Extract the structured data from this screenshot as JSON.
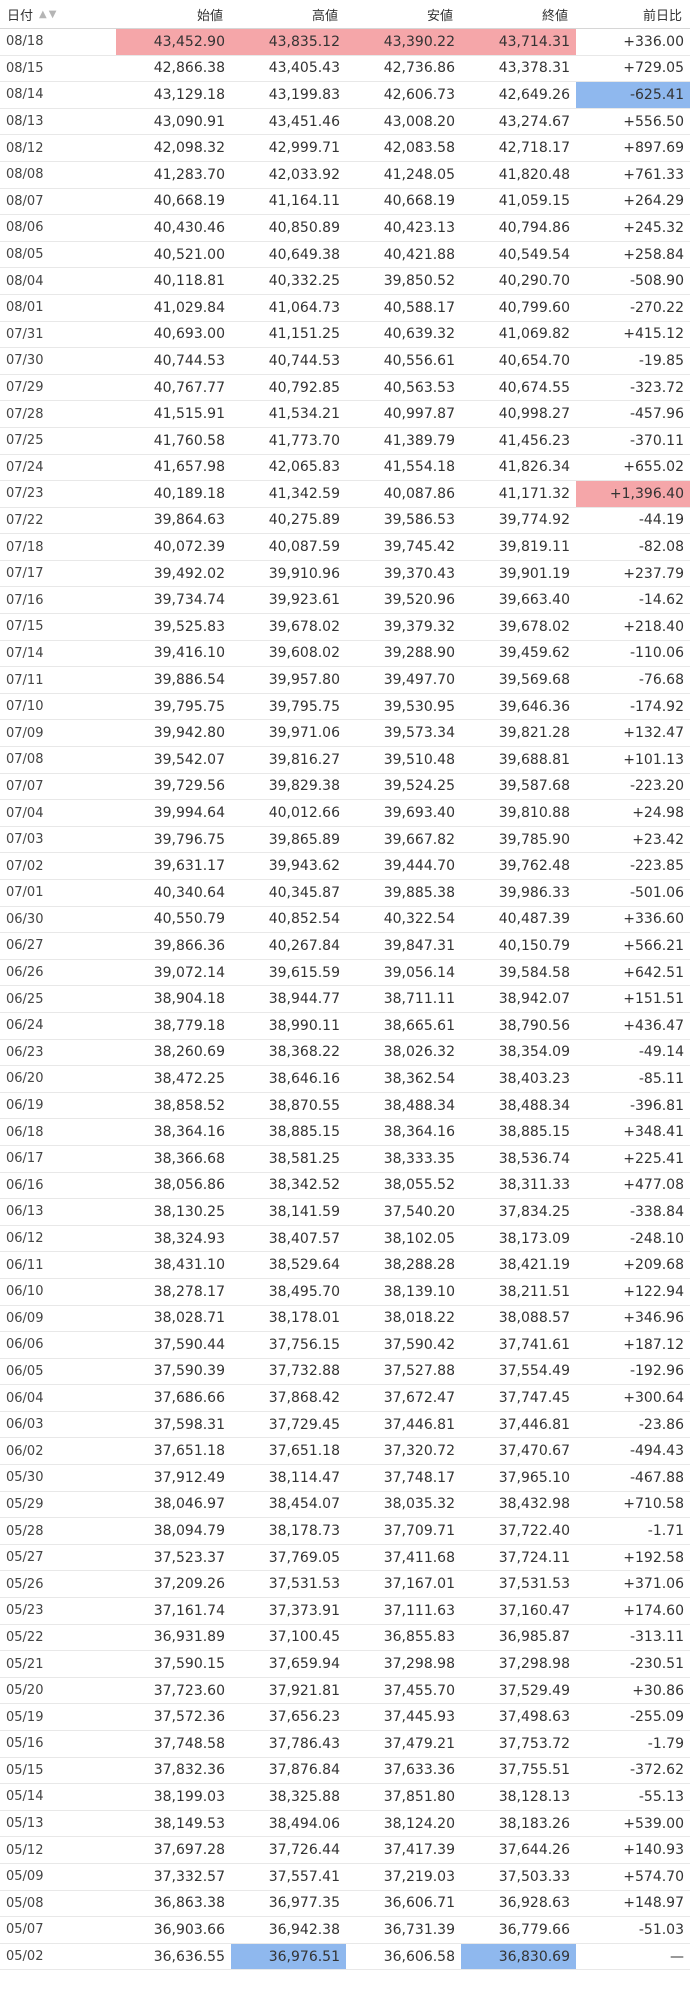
{
  "header": {
    "date": "日付",
    "open": "始値",
    "high": "高値",
    "low": "安値",
    "close": "終値",
    "change": "前日比",
    "sort_icons": [
      "sort-up-icon",
      "sort-down-icon"
    ]
  },
  "colors": {
    "positive": "#e02020",
    "negative": "#1a66c9",
    "highlight_red": "#f5a6a9",
    "highlight_blue": "#8fb8ee"
  },
  "rows": [
    {
      "date": "08/18",
      "open": "43,452.90",
      "high": "43,835.12",
      "low": "43,390.22",
      "close": "43,714.31",
      "change": "+336.00"
    },
    {
      "date": "08/15",
      "open": "42,866.38",
      "high": "43,405.43",
      "low": "42,736.86",
      "close": "43,378.31",
      "change": "+729.05"
    },
    {
      "date": "08/14",
      "open": "43,129.18",
      "high": "43,199.83",
      "low": "42,606.73",
      "close": "42,649.26",
      "change": "-625.41"
    },
    {
      "date": "08/13",
      "open": "43,090.91",
      "high": "43,451.46",
      "low": "43,008.20",
      "close": "43,274.67",
      "change": "+556.50"
    },
    {
      "date": "08/12",
      "open": "42,098.32",
      "high": "42,999.71",
      "low": "42,083.58",
      "close": "42,718.17",
      "change": "+897.69"
    },
    {
      "date": "08/08",
      "open": "41,283.70",
      "high": "42,033.92",
      "low": "41,248.05",
      "close": "41,820.48",
      "change": "+761.33"
    },
    {
      "date": "08/07",
      "open": "40,668.19",
      "high": "41,164.11",
      "low": "40,668.19",
      "close": "41,059.15",
      "change": "+264.29"
    },
    {
      "date": "08/06",
      "open": "40,430.46",
      "high": "40,850.89",
      "low": "40,423.13",
      "close": "40,794.86",
      "change": "+245.32"
    },
    {
      "date": "08/05",
      "open": "40,521.00",
      "high": "40,649.38",
      "low": "40,421.88",
      "close": "40,549.54",
      "change": "+258.84"
    },
    {
      "date": "08/04",
      "open": "40,118.81",
      "high": "40,332.25",
      "low": "39,850.52",
      "close": "40,290.70",
      "change": "-508.90"
    },
    {
      "date": "08/01",
      "open": "41,029.84",
      "high": "41,064.73",
      "low": "40,588.17",
      "close": "40,799.60",
      "change": "-270.22"
    },
    {
      "date": "07/31",
      "open": "40,693.00",
      "high": "41,151.25",
      "low": "40,639.32",
      "close": "41,069.82",
      "change": "+415.12"
    },
    {
      "date": "07/30",
      "open": "40,744.53",
      "high": "40,744.53",
      "low": "40,556.61",
      "close": "40,654.70",
      "change": "-19.85"
    },
    {
      "date": "07/29",
      "open": "40,767.77",
      "high": "40,792.85",
      "low": "40,563.53",
      "close": "40,674.55",
      "change": "-323.72"
    },
    {
      "date": "07/28",
      "open": "41,515.91",
      "high": "41,534.21",
      "low": "40,997.87",
      "close": "40,998.27",
      "change": "-457.96"
    },
    {
      "date": "07/25",
      "open": "41,760.58",
      "high": "41,773.70",
      "low": "41,389.79",
      "close": "41,456.23",
      "change": "-370.11"
    },
    {
      "date": "07/24",
      "open": "41,657.98",
      "high": "42,065.83",
      "low": "41,554.18",
      "close": "41,826.34",
      "change": "+655.02"
    },
    {
      "date": "07/23",
      "open": "40,189.18",
      "high": "41,342.59",
      "low": "40,087.86",
      "close": "41,171.32",
      "change": "+1,396.40"
    },
    {
      "date": "07/22",
      "open": "39,864.63",
      "high": "40,275.89",
      "low": "39,586.53",
      "close": "39,774.92",
      "change": "-44.19"
    },
    {
      "date": "07/18",
      "open": "40,072.39",
      "high": "40,087.59",
      "low": "39,745.42",
      "close": "39,819.11",
      "change": "-82.08"
    },
    {
      "date": "07/17",
      "open": "39,492.02",
      "high": "39,910.96",
      "low": "39,370.43",
      "close": "39,901.19",
      "change": "+237.79"
    },
    {
      "date": "07/16",
      "open": "39,734.74",
      "high": "39,923.61",
      "low": "39,520.96",
      "close": "39,663.40",
      "change": "-14.62"
    },
    {
      "date": "07/15",
      "open": "39,525.83",
      "high": "39,678.02",
      "low": "39,379.32",
      "close": "39,678.02",
      "change": "+218.40"
    },
    {
      "date": "07/14",
      "open": "39,416.10",
      "high": "39,608.02",
      "low": "39,288.90",
      "close": "39,459.62",
      "change": "-110.06"
    },
    {
      "date": "07/11",
      "open": "39,886.54",
      "high": "39,957.80",
      "low": "39,497.70",
      "close": "39,569.68",
      "change": "-76.68"
    },
    {
      "date": "07/10",
      "open": "39,795.75",
      "high": "39,795.75",
      "low": "39,530.95",
      "close": "39,646.36",
      "change": "-174.92"
    },
    {
      "date": "07/09",
      "open": "39,942.80",
      "high": "39,971.06",
      "low": "39,573.34",
      "close": "39,821.28",
      "change": "+132.47"
    },
    {
      "date": "07/08",
      "open": "39,542.07",
      "high": "39,816.27",
      "low": "39,510.48",
      "close": "39,688.81",
      "change": "+101.13"
    },
    {
      "date": "07/07",
      "open": "39,729.56",
      "high": "39,829.38",
      "low": "39,524.25",
      "close": "39,587.68",
      "change": "-223.20"
    },
    {
      "date": "07/04",
      "open": "39,994.64",
      "high": "40,012.66",
      "low": "39,693.40",
      "close": "39,810.88",
      "change": "+24.98"
    },
    {
      "date": "07/03",
      "open": "39,796.75",
      "high": "39,865.89",
      "low": "39,667.82",
      "close": "39,785.90",
      "change": "+23.42"
    },
    {
      "date": "07/02",
      "open": "39,631.17",
      "high": "39,943.62",
      "low": "39,444.70",
      "close": "39,762.48",
      "change": "-223.85"
    },
    {
      "date": "07/01",
      "open": "40,340.64",
      "high": "40,345.87",
      "low": "39,885.38",
      "close": "39,986.33",
      "change": "-501.06"
    },
    {
      "date": "06/30",
      "open": "40,550.79",
      "high": "40,852.54",
      "low": "40,322.54",
      "close": "40,487.39",
      "change": "+336.60"
    },
    {
      "date": "06/27",
      "open": "39,866.36",
      "high": "40,267.84",
      "low": "39,847.31",
      "close": "40,150.79",
      "change": "+566.21"
    },
    {
      "date": "06/26",
      "open": "39,072.14",
      "high": "39,615.59",
      "low": "39,056.14",
      "close": "39,584.58",
      "change": "+642.51"
    },
    {
      "date": "06/25",
      "open": "38,904.18",
      "high": "38,944.77",
      "low": "38,711.11",
      "close": "38,942.07",
      "change": "+151.51"
    },
    {
      "date": "06/24",
      "open": "38,779.18",
      "high": "38,990.11",
      "low": "38,665.61",
      "close": "38,790.56",
      "change": "+436.47"
    },
    {
      "date": "06/23",
      "open": "38,260.69",
      "high": "38,368.22",
      "low": "38,026.32",
      "close": "38,354.09",
      "change": "-49.14"
    },
    {
      "date": "06/20",
      "open": "38,472.25",
      "high": "38,646.16",
      "low": "38,362.54",
      "close": "38,403.23",
      "change": "-85.11"
    },
    {
      "date": "06/19",
      "open": "38,858.52",
      "high": "38,870.55",
      "low": "38,488.34",
      "close": "38,488.34",
      "change": "-396.81"
    },
    {
      "date": "06/18",
      "open": "38,364.16",
      "high": "38,885.15",
      "low": "38,364.16",
      "close": "38,885.15",
      "change": "+348.41"
    },
    {
      "date": "06/17",
      "open": "38,366.68",
      "high": "38,581.25",
      "low": "38,333.35",
      "close": "38,536.74",
      "change": "+225.41"
    },
    {
      "date": "06/16",
      "open": "38,056.86",
      "high": "38,342.52",
      "low": "38,055.52",
      "close": "38,311.33",
      "change": "+477.08"
    },
    {
      "date": "06/13",
      "open": "38,130.25",
      "high": "38,141.59",
      "low": "37,540.20",
      "close": "37,834.25",
      "change": "-338.84"
    },
    {
      "date": "06/12",
      "open": "38,324.93",
      "high": "38,407.57",
      "low": "38,102.05",
      "close": "38,173.09",
      "change": "-248.10"
    },
    {
      "date": "06/11",
      "open": "38,431.10",
      "high": "38,529.64",
      "low": "38,288.28",
      "close": "38,421.19",
      "change": "+209.68"
    },
    {
      "date": "06/10",
      "open": "38,278.17",
      "high": "38,495.70",
      "low": "38,139.10",
      "close": "38,211.51",
      "change": "+122.94"
    },
    {
      "date": "06/09",
      "open": "38,028.71",
      "high": "38,178.01",
      "low": "38,018.22",
      "close": "38,088.57",
      "change": "+346.96"
    },
    {
      "date": "06/06",
      "open": "37,590.44",
      "high": "37,756.15",
      "low": "37,590.42",
      "close": "37,741.61",
      "change": "+187.12"
    },
    {
      "date": "06/05",
      "open": "37,590.39",
      "high": "37,732.88",
      "low": "37,527.88",
      "close": "37,554.49",
      "change": "-192.96"
    },
    {
      "date": "06/04",
      "open": "37,686.66",
      "high": "37,868.42",
      "low": "37,672.47",
      "close": "37,747.45",
      "change": "+300.64"
    },
    {
      "date": "06/03",
      "open": "37,598.31",
      "high": "37,729.45",
      "low": "37,446.81",
      "close": "37,446.81",
      "change": "-23.86"
    },
    {
      "date": "06/02",
      "open": "37,651.18",
      "high": "37,651.18",
      "low": "37,320.72",
      "close": "37,470.67",
      "change": "-494.43"
    },
    {
      "date": "05/30",
      "open": "37,912.49",
      "high": "38,114.47",
      "low": "37,748.17",
      "close": "37,965.10",
      "change": "-467.88"
    },
    {
      "date": "05/29",
      "open": "38,046.97",
      "high": "38,454.07",
      "low": "38,035.32",
      "close": "38,432.98",
      "change": "+710.58"
    },
    {
      "date": "05/28",
      "open": "38,094.79",
      "high": "38,178.73",
      "low": "37,709.71",
      "close": "37,722.40",
      "change": "-1.71"
    },
    {
      "date": "05/27",
      "open": "37,523.37",
      "high": "37,769.05",
      "low": "37,411.68",
      "close": "37,724.11",
      "change": "+192.58"
    },
    {
      "date": "05/26",
      "open": "37,209.26",
      "high": "37,531.53",
      "low": "37,167.01",
      "close": "37,531.53",
      "change": "+371.06"
    },
    {
      "date": "05/23",
      "open": "37,161.74",
      "high": "37,373.91",
      "low": "37,111.63",
      "close": "37,160.47",
      "change": "+174.60"
    },
    {
      "date": "05/22",
      "open": "36,931.89",
      "high": "37,100.45",
      "low": "36,855.83",
      "close": "36,985.87",
      "change": "-313.11"
    },
    {
      "date": "05/21",
      "open": "37,590.15",
      "high": "37,659.94",
      "low": "37,298.98",
      "close": "37,298.98",
      "change": "-230.51"
    },
    {
      "date": "05/20",
      "open": "37,723.60",
      "high": "37,921.81",
      "low": "37,455.70",
      "close": "37,529.49",
      "change": "+30.86"
    },
    {
      "date": "05/19",
      "open": "37,572.36",
      "high": "37,656.23",
      "low": "37,445.93",
      "close": "37,498.63",
      "change": "-255.09"
    },
    {
      "date": "05/16",
      "open": "37,748.58",
      "high": "37,786.43",
      "low": "37,479.21",
      "close": "37,753.72",
      "change": "-1.79"
    },
    {
      "date": "05/15",
      "open": "37,832.36",
      "high": "37,876.84",
      "low": "37,633.36",
      "close": "37,755.51",
      "change": "-372.62"
    },
    {
      "date": "05/14",
      "open": "38,199.03",
      "high": "38,325.88",
      "low": "37,851.80",
      "close": "38,128.13",
      "change": "-55.13"
    },
    {
      "date": "05/13",
      "open": "38,149.53",
      "high": "38,494.06",
      "low": "38,124.20",
      "close": "38,183.26",
      "change": "+539.00"
    },
    {
      "date": "05/12",
      "open": "37,697.28",
      "high": "37,726.44",
      "low": "37,417.39",
      "close": "37,644.26",
      "change": "+140.93"
    },
    {
      "date": "05/09",
      "open": "37,332.57",
      "high": "37,557.41",
      "low": "37,219.03",
      "close": "37,503.33",
      "change": "+574.70"
    },
    {
      "date": "05/08",
      "open": "36,863.38",
      "high": "36,977.35",
      "low": "36,606.71",
      "close": "36,928.63",
      "change": "+148.97"
    },
    {
      "date": "05/07",
      "open": "36,903.66",
      "high": "36,942.38",
      "low": "36,731.39",
      "close": "36,779.66",
      "change": "-51.03"
    },
    {
      "date": "05/02",
      "open": "36,636.55",
      "high": "36,976.51",
      "low": "36,606.58",
      "close": "36,830.69",
      "change": "—"
    }
  ],
  "highlights": {
    "max_open_row": 0,
    "max_high_row": 0,
    "max_low_row": 0,
    "max_close_row": 0,
    "max_change_row": 17,
    "min_open_row": 73,
    "min_high_row": 72,
    "min_low_row": 73,
    "min_close_row": 72,
    "min_change_row": 2
  }
}
